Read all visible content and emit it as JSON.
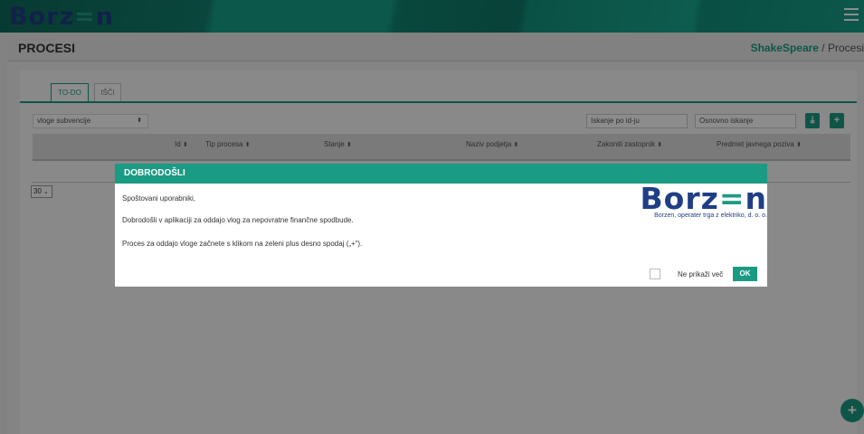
{
  "app": {
    "logo_text_prefix": "Borz",
    "logo_text_mid": "=",
    "logo_text_suffix": "n",
    "accent_color": "#1a9b83",
    "brand_color": "#1f3e86"
  },
  "header": {
    "page_title": "PROCESI",
    "breadcrumb": {
      "link": "ShakeSpeare",
      "separator": " / ",
      "current": "Procesi"
    }
  },
  "tabs": [
    {
      "label": "TO-DO",
      "active": true
    },
    {
      "label": "IŠČI",
      "active": false
    }
  ],
  "filters": {
    "process_select_value": "vloge subvencije",
    "search_id_placeholder": "Iskanje po id-ju",
    "search_basic_placeholder": "Osnovno iskanje",
    "download_icon": "download-icon",
    "add_icon": "plus-icon"
  },
  "table": {
    "columns": [
      "Id",
      "Tip procesa",
      "Stanje",
      "Naziv podjetja",
      "Zakoniti zastopnik",
      "Predmet javnega poziva"
    ],
    "sort_glyph": "⬍"
  },
  "pagination": {
    "page_size": "30"
  },
  "fab": {
    "icon": "plus-icon",
    "glyph": "+"
  },
  "modal": {
    "title": "DOBRODOŠLI",
    "greeting": "Spoštovani uporabniki,",
    "line1": "Dobrodošli v aplikaciji za oddajo vlog za nepovratne finančne spodbude.",
    "line2": "Proces za oddajo vloge začnete s klikom na zeleni plus desno spodaj („+“).",
    "brand_tagline": "Borzen, operater trga z elektriko, d. o. o.",
    "dont_show_label": "Ne prikaži več",
    "ok_label": "OK"
  }
}
